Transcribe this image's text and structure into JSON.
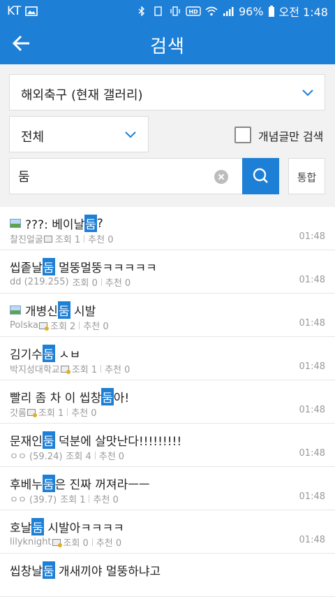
{
  "status_bar": {
    "carrier": "KT",
    "battery": "96%",
    "clock": "오전 1:48"
  },
  "app_bar": {
    "title": "검색"
  },
  "filters": {
    "gallery_select": "해외축구 (현재 갤러리)",
    "scope_select": "전체",
    "concept_only_label": "개념글만 검색",
    "concept_only_checked": false,
    "search_value": "둠",
    "integrated_label": "통합"
  },
  "colors": {
    "accent": "#1e7fd6"
  },
  "results": [
    {
      "has_image": true,
      "pre": "???: 베이날",
      "hl": "둠",
      "post": "?",
      "author": "찰진얼굴",
      "badge": "plain",
      "views": "조회 1",
      "recs": "추천 0",
      "time": "01:48"
    },
    {
      "has_image": false,
      "pre": "씹좉날",
      "hl": "둠",
      "post": " 멀뚱멀뚱ㅋㅋㅋㅋㅋ",
      "author": "dd (219.255)",
      "badge": "none",
      "views": "조회 0",
      "recs": "추천 0",
      "time": "01:48"
    },
    {
      "has_image": true,
      "pre": "개병신",
      "hl": "둠",
      "post": " 시발",
      "author": "Polska",
      "badge": "gold",
      "views": "조회 2",
      "recs": "추천 0",
      "time": "01:48"
    },
    {
      "has_image": false,
      "pre": "김기수",
      "hl": "둠",
      "post": " ㅅㅂ",
      "author": "박지성대학교",
      "badge": "gold",
      "views": "조회 1",
      "recs": "추천 0",
      "time": "01:48"
    },
    {
      "has_image": false,
      "pre": "빨리 좀 차 이 씹창",
      "hl": "둠",
      "post": "아!",
      "author": "갓롬",
      "badge": "gold",
      "views": "조회 1",
      "recs": "추천 0",
      "time": "01:48"
    },
    {
      "has_image": false,
      "pre": "문재인",
      "hl": "둠",
      "post": " 덕분에 살맛난다!!!!!!!!!",
      "author": "ㅇㅇ (59.24)",
      "badge": "none",
      "views": "조회 4",
      "recs": "추천 0",
      "time": "01:48"
    },
    {
      "has_image": false,
      "pre": "후베누",
      "hl": "둠",
      "post": "은 진짜 꺼져라ㅡㅡ",
      "author": "ㅇㅇ (39.7)",
      "badge": "none",
      "views": "조회 1",
      "recs": "추천 0",
      "time": "01:48"
    },
    {
      "has_image": false,
      "pre": "호날",
      "hl": "둠",
      "post": " 시발아ㅋㅋㅋㅋ",
      "author": "lilyknight",
      "badge": "gold",
      "views": "조회 0",
      "recs": "추천 0",
      "time": "01:48"
    },
    {
      "has_image": false,
      "pre": "씹창날",
      "hl": "둠",
      "post": " 개새끼야 멀뚱하냐고",
      "author": "",
      "badge": "none",
      "views": "",
      "recs": "",
      "time": ""
    }
  ]
}
